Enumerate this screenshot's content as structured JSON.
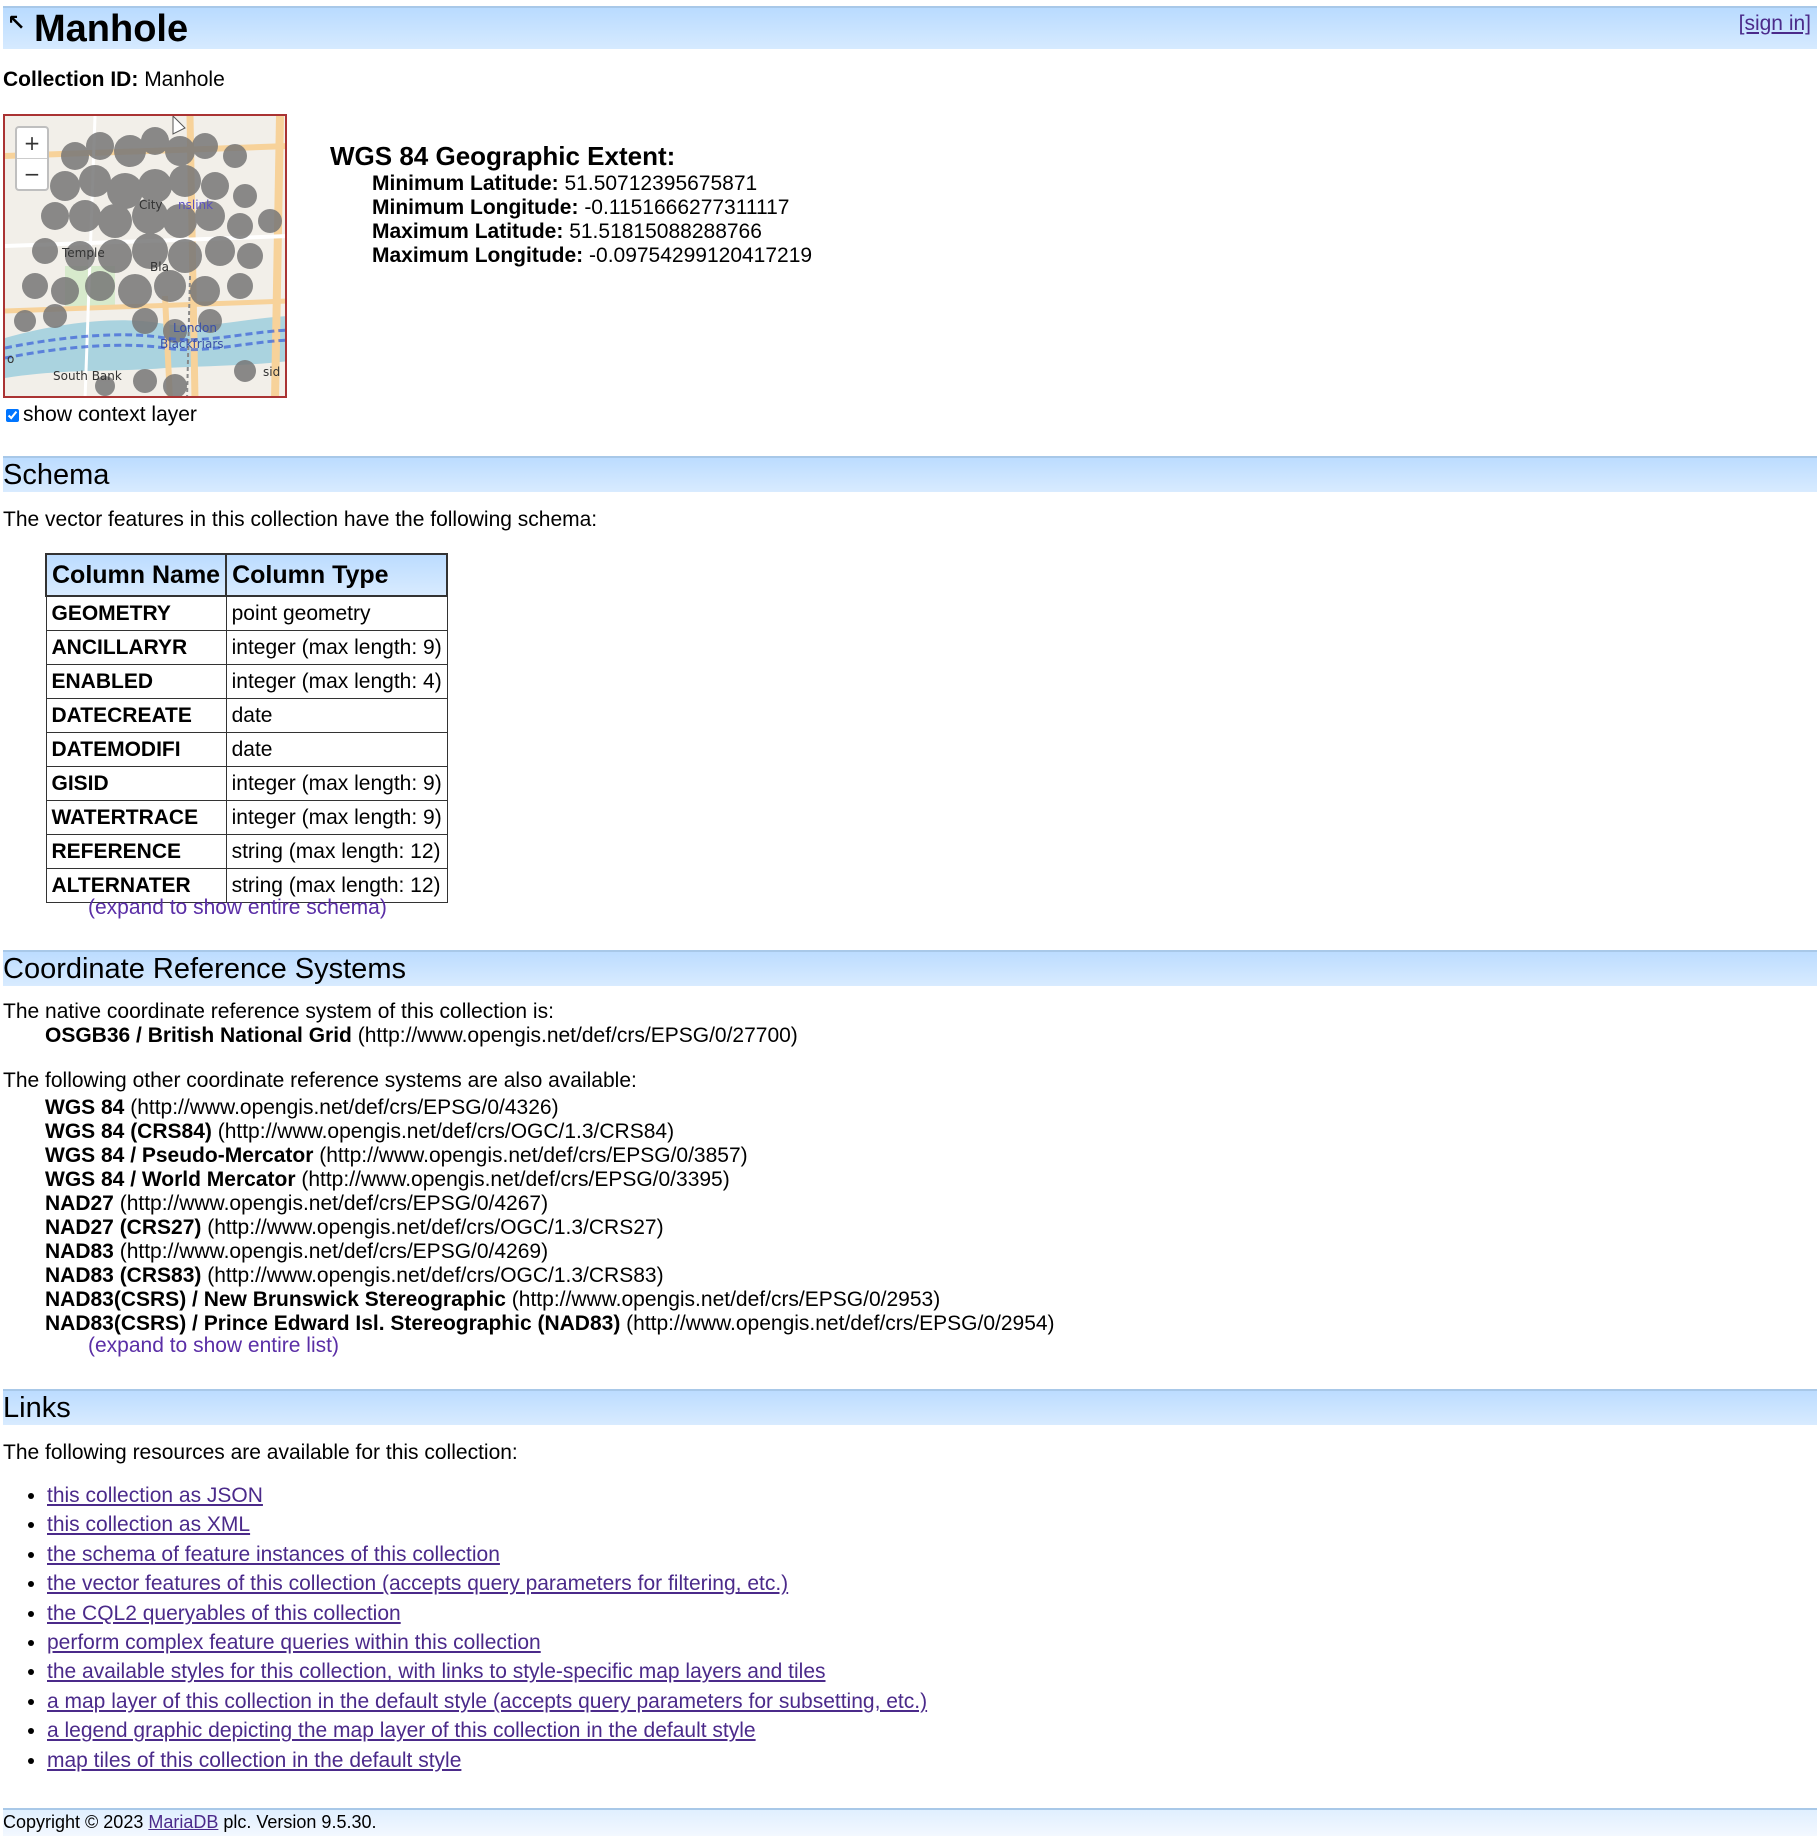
{
  "header": {
    "title": "Manhole",
    "sign_in": "[sign in]"
  },
  "collection_id": {
    "label": "Collection ID:",
    "value": "Manhole"
  },
  "map": {
    "zoom_in": "+",
    "zoom_out": "−",
    "place_labels": [
      "City",
      "nslink",
      "Temple",
      "Bla",
      "London",
      "Blackfriars",
      "South Bank",
      "sid",
      "o"
    ],
    "colors": {
      "water": "#aad3df",
      "road": "#f7d29a",
      "feature": "#777777",
      "border": "#aa3333"
    }
  },
  "context_layer": {
    "label": "show context layer",
    "checked": true
  },
  "extent": {
    "heading": "WGS 84 Geographic Extent:",
    "rows": [
      {
        "label": "Minimum Latitude:",
        "value": "51.50712395675871"
      },
      {
        "label": "Minimum Longitude:",
        "value": "-0.1151666277311117"
      },
      {
        "label": "Maximum Latitude:",
        "value": "51.51815088288766"
      },
      {
        "label": "Maximum Longitude:",
        "value": "-0.09754299120417219"
      }
    ]
  },
  "schema": {
    "heading": "Schema",
    "intro": "The vector features in this collection have the following schema:",
    "columns": [
      "Column Name",
      "Column Type"
    ],
    "rows": [
      {
        "name": "GEOMETRY",
        "type": "point geometry"
      },
      {
        "name": "ANCILLARYR",
        "type": "integer (max length: 9)"
      },
      {
        "name": "ENABLED",
        "type": "integer (max length: 4)"
      },
      {
        "name": "DATECREATE",
        "type": "date"
      },
      {
        "name": "DATEMODIFI",
        "type": "date"
      },
      {
        "name": "GISID",
        "type": "integer (max length: 9)"
      },
      {
        "name": "WATERTRACE",
        "type": "integer (max length: 9)"
      },
      {
        "name": "REFERENCE",
        "type": "string (max length: 12)"
      },
      {
        "name": "ALTERNATER",
        "type": "string (max length: 12)"
      }
    ],
    "expand": "(expand to show entire schema)"
  },
  "crs": {
    "heading": "Coordinate Reference Systems",
    "native_intro": "The native coordinate reference system of this collection is:",
    "native": {
      "name": "OSGB36 / British National Grid",
      "uri": "(http://www.opengis.net/def/crs/EPSG/0/27700)"
    },
    "others_intro": "The following other coordinate reference systems are also available:",
    "others": [
      {
        "name": "WGS 84",
        "uri": "(http://www.opengis.net/def/crs/EPSG/0/4326)"
      },
      {
        "name": "WGS 84 (CRS84)",
        "uri": "(http://www.opengis.net/def/crs/OGC/1.3/CRS84)"
      },
      {
        "name": "WGS 84 / Pseudo-Mercator",
        "uri": "(http://www.opengis.net/def/crs/EPSG/0/3857)"
      },
      {
        "name": "WGS 84 / World Mercator",
        "uri": "(http://www.opengis.net/def/crs/EPSG/0/3395)"
      },
      {
        "name": "NAD27",
        "uri": "(http://www.opengis.net/def/crs/EPSG/0/4267)"
      },
      {
        "name": "NAD27 (CRS27)",
        "uri": "(http://www.opengis.net/def/crs/OGC/1.3/CRS27)"
      },
      {
        "name": "NAD83",
        "uri": "(http://www.opengis.net/def/crs/EPSG/0/4269)"
      },
      {
        "name": "NAD83 (CRS83)",
        "uri": "(http://www.opengis.net/def/crs/OGC/1.3/CRS83)"
      },
      {
        "name": "NAD83(CSRS) / New Brunswick Stereographic",
        "uri": "(http://www.opengis.net/def/crs/EPSG/0/2953)"
      },
      {
        "name": "NAD83(CSRS) / Prince Edward Isl. Stereographic (NAD83)",
        "uri": "(http://www.opengis.net/def/crs/EPSG/0/2954)"
      }
    ],
    "expand": "(expand to show entire list)"
  },
  "links": {
    "heading": "Links",
    "intro": "The following resources are available for this collection:",
    "items": [
      "this collection as JSON",
      "this collection as XML",
      "the schema of feature instances of this collection",
      "the vector features of this collection (accepts query parameters for filtering, etc.)",
      "the CQL2 queryables of this collection",
      "perform complex feature queries within this collection",
      "the available styles for this collection, with links to style-specific map layers and tiles",
      "a map layer of this collection in the default style (accepts query parameters for subsetting, etc.)",
      "a legend graphic depicting the map layer of this collection in the default style",
      "map tiles of this collection in the default style"
    ]
  },
  "footer": {
    "prefix": "Copyright © 2023 ",
    "link": "MariaDB",
    "suffix": " plc. Version 9.5.30."
  }
}
